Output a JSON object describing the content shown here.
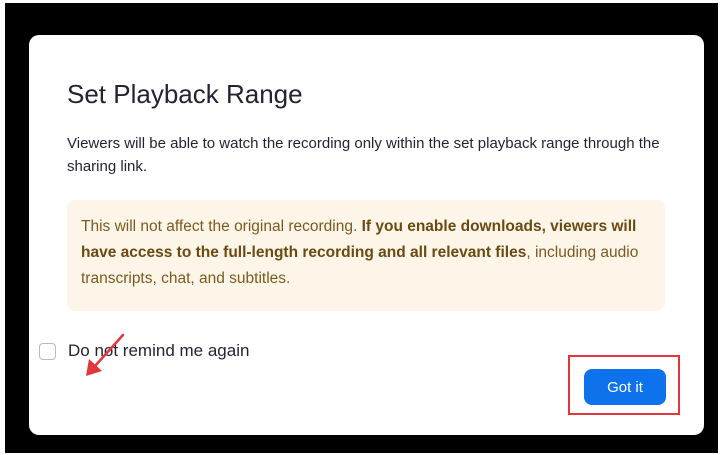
{
  "dialog": {
    "title": "Set Playback Range",
    "description": "Viewers will be able to watch the recording only within the set playback range through the sharing link.",
    "notice": {
      "part1": "This will not affect the original recording. ",
      "bold": "If you enable downloads, viewers will have access to the full-length recording and all relevant files",
      "part2": ", including audio transcripts, chat, and subtitles."
    },
    "checkbox_label": "Do not remind me again",
    "checkbox_checked": false,
    "confirm_label": "Got it"
  },
  "colors": {
    "backdrop": "#000000",
    "primary_button": "#0e72ed",
    "notice_background": "#fef5e9",
    "annotation": "#e2353c"
  },
  "annotations": {
    "arrow_target": "do-not-remind-checkbox",
    "highlight_target": "got-it-button"
  }
}
